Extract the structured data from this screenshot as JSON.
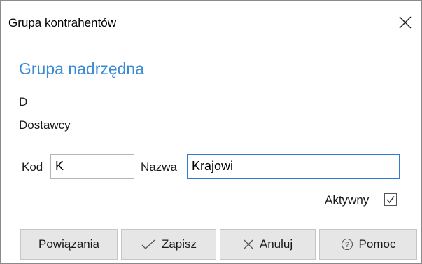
{
  "window": {
    "title": "Grupa kontrahentów",
    "close_icon": "close-icon"
  },
  "parent_group": {
    "heading": "Grupa nadrzędna",
    "code": "D",
    "name": "Dostawcy"
  },
  "form": {
    "code_label": "Kod",
    "code_value": "K",
    "name_label": "Nazwa",
    "name_value": "Krajowi",
    "active_label": "Aktywny",
    "active_checked": true
  },
  "buttons": {
    "links_label": "Powiązania",
    "save_label": "Zapisz",
    "save_icon": "checkmark-icon",
    "cancel_label": "Anuluj",
    "cancel_icon": "x-icon",
    "help_label": "Pomoc",
    "help_icon": "question-circle-icon"
  },
  "colors": {
    "heading": "#3b8ad4",
    "focused_input_border": "#2f7bd1",
    "button_bg": "#e6e6e6"
  }
}
